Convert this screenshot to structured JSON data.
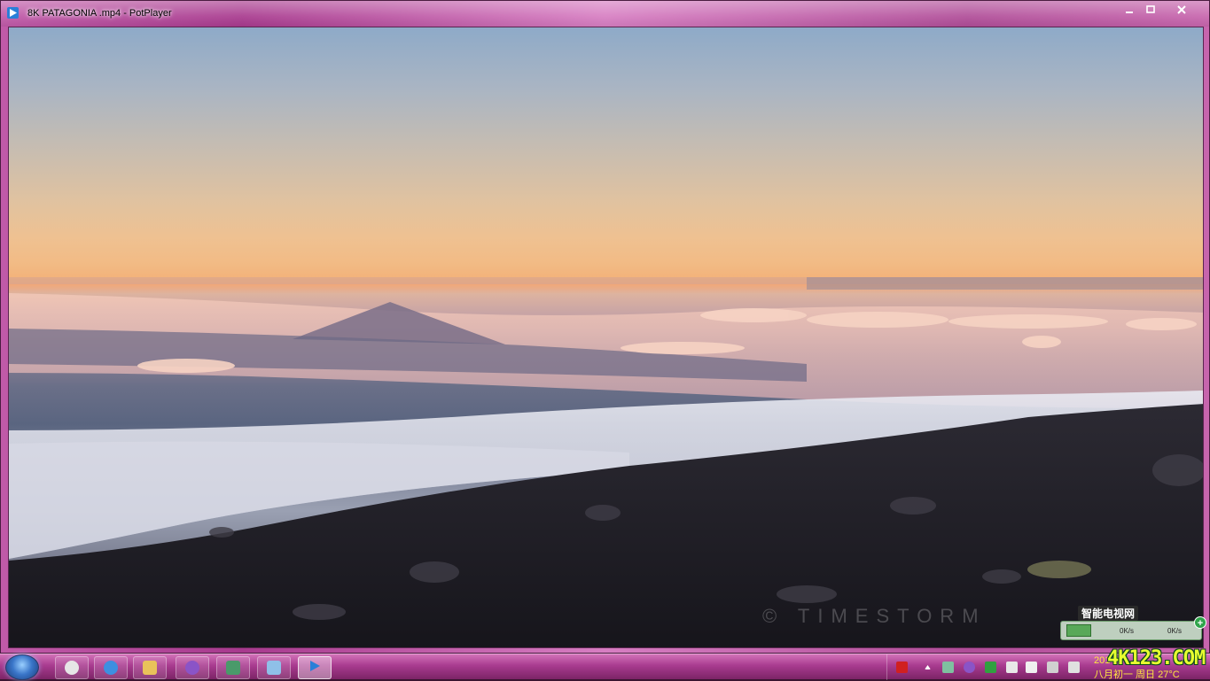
{
  "window": {
    "title": "8K PATAGONIA .mp4 - PotPlayer",
    "icons": {
      "app": "play-icon",
      "minimize": "minimize-icon",
      "maximize": "maximize-icon",
      "close": "close-icon"
    }
  },
  "video": {
    "watermark": "© TIMESTORM",
    "scene": "mountain-shadow-over-sea-of-clouds"
  },
  "overlay": {
    "site_logo": "智能电视网",
    "site_url": "4K123.COM",
    "net_speed": {
      "upload": "0K/s",
      "download": "0K/s",
      "plus": "+"
    }
  },
  "taskbar": {
    "buttons": [
      {
        "name": "start-orb"
      },
      {
        "name": "app-1",
        "icon": "cat-icon"
      },
      {
        "name": "app-2",
        "icon": "internet-explorer-icon"
      },
      {
        "name": "app-3",
        "icon": "file-explorer-icon"
      },
      {
        "name": "app-4",
        "icon": "media-player-icon"
      },
      {
        "name": "app-5",
        "icon": "computer-icon"
      },
      {
        "name": "app-6",
        "icon": "notepad-icon"
      },
      {
        "name": "app-7",
        "icon": "potplayer-icon",
        "active": true
      }
    ],
    "tray": {
      "clock_year": "201",
      "clock_date": "八月初一 周日 27°C"
    }
  },
  "colors": {
    "frame": "#b04d98",
    "taskbar": "#a83b8f",
    "clock": "#ffe640",
    "site_url": "#e8ff30"
  }
}
